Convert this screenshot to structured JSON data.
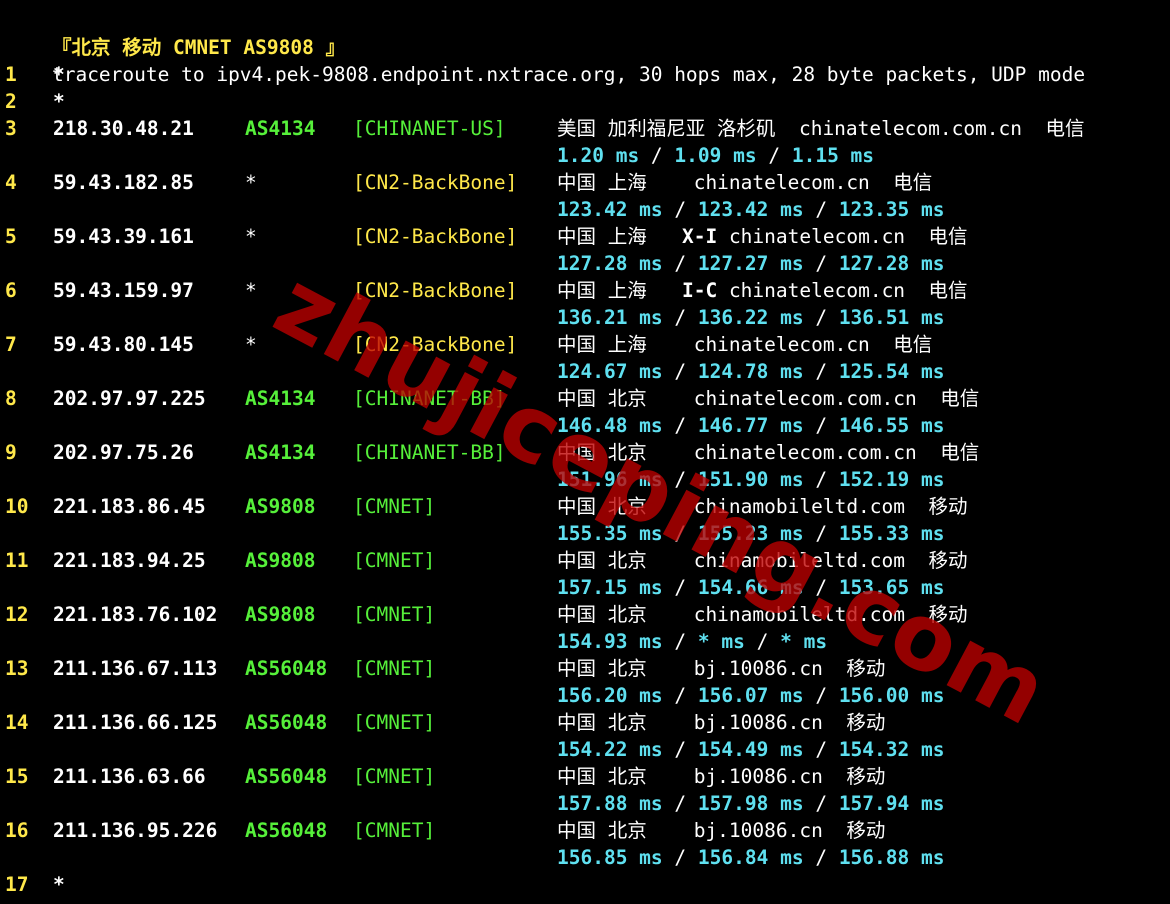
{
  "header": {
    "title": "『北京 移动 CMNET AS9808 』",
    "command": "traceroute to ipv4.pek-9808.endpoint.nxtrace.org, 30 hops max, 28 byte packets, UDP mode"
  },
  "hops": [
    {
      "hop": "1",
      "star": "*"
    },
    {
      "hop": "2",
      "star": "*"
    },
    {
      "hop": "3",
      "ip": "218.30.48.21",
      "asn": "AS4134",
      "tag": "[CHINANET-US]",
      "tag_color": "green",
      "location": "美国 加利福尼亚 洛杉矶  chinatelecom.com.cn  电信",
      "rtt1": "1.20 ms",
      "rtt2": "1.09 ms",
      "rtt3": "1.15 ms"
    },
    {
      "hop": "4",
      "ip": "59.43.182.85",
      "asn": "*",
      "tag": "[CN2-BackBone]",
      "tag_color": "yellow",
      "location": "中国 上海    chinatelecom.cn  电信",
      "rtt1": "123.42 ms",
      "rtt2": "123.42 ms",
      "rtt3": "123.35 ms"
    },
    {
      "hop": "5",
      "ip": "59.43.39.161",
      "asn": "*",
      "tag": "[CN2-BackBone]",
      "tag_color": "yellow",
      "location_prefix": "中国 上海   ",
      "location_code": "X-I",
      "location_suffix": " chinatelecom.cn  电信",
      "rtt1": "127.28 ms",
      "rtt2": "127.27 ms",
      "rtt3": "127.28 ms"
    },
    {
      "hop": "6",
      "ip": "59.43.159.97",
      "asn": "*",
      "tag": "[CN2-BackBone]",
      "tag_color": "yellow",
      "location_prefix": "中国 上海   ",
      "location_code": "I-C",
      "location_suffix": " chinatelecom.cn  电信",
      "rtt1": "136.21 ms",
      "rtt2": "136.22 ms",
      "rtt3": "136.51 ms"
    },
    {
      "hop": "7",
      "ip": "59.43.80.145",
      "asn": "*",
      "tag": "[CN2-BackBone]",
      "tag_color": "yellow",
      "location": "中国 上海    chinatelecom.cn  电信",
      "rtt1": "124.67 ms",
      "rtt2": "124.78 ms",
      "rtt3": "125.54 ms"
    },
    {
      "hop": "8",
      "ip": "202.97.97.225",
      "asn": "AS4134",
      "tag": "[CHINANET-BB]",
      "tag_color": "green",
      "location": "中国 北京    chinatelecom.com.cn  电信",
      "rtt1": "146.48 ms",
      "rtt2": "146.77 ms",
      "rtt3": "146.55 ms"
    },
    {
      "hop": "9",
      "ip": "202.97.75.26",
      "asn": "AS4134",
      "tag": "[CHINANET-BB]",
      "tag_color": "green",
      "location": "中国 北京    chinatelecom.com.cn  电信",
      "rtt1": "151.96 ms",
      "rtt2": "151.90 ms",
      "rtt3": "152.19 ms"
    },
    {
      "hop": "10",
      "ip": "221.183.86.45",
      "asn": "AS9808",
      "tag": "[CMNET]",
      "tag_color": "green",
      "location": "中国 北京    chinamobileltd.com  移动",
      "rtt1": "155.35 ms",
      "rtt2": "155.23 ms",
      "rtt3": "155.33 ms"
    },
    {
      "hop": "11",
      "ip": "221.183.94.25",
      "asn": "AS9808",
      "tag": "[CMNET]",
      "tag_color": "green",
      "location": "中国 北京    chinamobileltd.com  移动",
      "rtt1": "157.15 ms",
      "rtt2": "154.66 ms",
      "rtt3": "153.65 ms"
    },
    {
      "hop": "12",
      "ip": "221.183.76.102",
      "asn": "AS9808",
      "tag": "[CMNET]",
      "tag_color": "green",
      "location": "中国 北京    chinamobileltd.com  移动",
      "rtt1": "154.93 ms",
      "rtt2": "* ms",
      "rtt3": "* ms"
    },
    {
      "hop": "13",
      "ip": "211.136.67.113",
      "asn": "AS56048",
      "tag": "[CMNET]",
      "tag_color": "green",
      "location": "中国 北京    bj.10086.cn  移动",
      "rtt1": "156.20 ms",
      "rtt2": "156.07 ms",
      "rtt3": "156.00 ms"
    },
    {
      "hop": "14",
      "ip": "211.136.66.125",
      "asn": "AS56048",
      "tag": "[CMNET]",
      "tag_color": "green",
      "location": "中国 北京    bj.10086.cn  移动",
      "rtt1": "154.22 ms",
      "rtt2": "154.49 ms",
      "rtt3": "154.32 ms"
    },
    {
      "hop": "15",
      "ip": "211.136.63.66",
      "asn": "AS56048",
      "tag": "[CMNET]",
      "tag_color": "green",
      "location": "中国 北京    bj.10086.cn  移动",
      "rtt1": "157.88 ms",
      "rtt2": "157.98 ms",
      "rtt3": "157.94 ms"
    },
    {
      "hop": "16",
      "ip": "211.136.95.226",
      "asn": "AS56048",
      "tag": "[CMNET]",
      "tag_color": "green",
      "location": "中国 北京    bj.10086.cn  移动",
      "rtt1": "156.85 ms",
      "rtt2": "156.84 ms",
      "rtt3": "156.88 ms"
    },
    {
      "hop": "17",
      "star": "*"
    }
  ],
  "rtt_separator": " / ",
  "watermark": "zhujiceping.com",
  "colors": {
    "background": "#000000",
    "yellow": "#ffe84a",
    "green": "#56f03a",
    "cyan": "#5fe0f0",
    "white": "#ffffff",
    "watermark": "#be0000"
  }
}
